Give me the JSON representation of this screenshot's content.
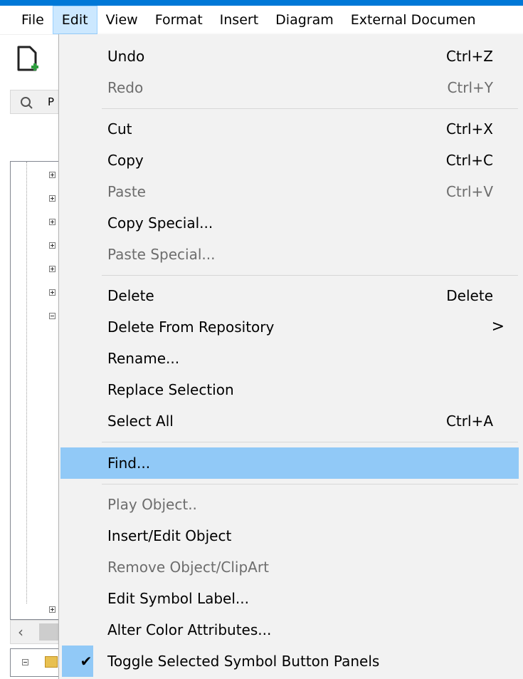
{
  "menubar": {
    "items": [
      {
        "label": "File"
      },
      {
        "label": "Edit"
      },
      {
        "label": "View"
      },
      {
        "label": "Format"
      },
      {
        "label": "Insert"
      },
      {
        "label": "Diagram"
      },
      {
        "label": "External Documen"
      }
    ]
  },
  "background": {
    "toolbar_partial_text": "P"
  },
  "edit_menu": {
    "items": [
      {
        "label": "Undo",
        "shortcut": "Ctrl+Z",
        "disabled": false
      },
      {
        "label": "Redo",
        "shortcut": "Ctrl+Y",
        "disabled": true
      },
      {
        "label": "Cut",
        "shortcut": "Ctrl+X",
        "disabled": false
      },
      {
        "label": "Copy",
        "shortcut": "Ctrl+C",
        "disabled": false
      },
      {
        "label": "Paste",
        "shortcut": "Ctrl+V",
        "disabled": true
      },
      {
        "label": "Copy Special...",
        "shortcut": "",
        "disabled": false
      },
      {
        "label": "Paste Special...",
        "shortcut": "",
        "disabled": true
      },
      {
        "label": "Delete",
        "shortcut": "Delete",
        "disabled": false
      },
      {
        "label": "Delete From Repository",
        "submenu_arrow": ">",
        "disabled": false
      },
      {
        "label": "Rename...",
        "shortcut": "",
        "disabled": false
      },
      {
        "label": "Replace Selection",
        "shortcut": "",
        "disabled": false
      },
      {
        "label": "Select All",
        "shortcut": "Ctrl+A",
        "disabled": false
      },
      {
        "label": "Find...",
        "shortcut": "",
        "disabled": false,
        "highlighted": true
      },
      {
        "label": "Play Object..",
        "shortcut": "",
        "disabled": true
      },
      {
        "label": "Insert/Edit Object",
        "shortcut": "",
        "disabled": false
      },
      {
        "label": "Remove Object/ClipArt",
        "shortcut": "",
        "disabled": true
      },
      {
        "label": "Edit Symbol Label...",
        "shortcut": "",
        "disabled": false
      },
      {
        "label": "Alter Color Attributes...",
        "shortcut": "",
        "disabled": false
      },
      {
        "label": "Toggle Selected Symbol Button Panels",
        "shortcut": "",
        "disabled": false,
        "checked": true,
        "check_glyph": "✔"
      }
    ]
  },
  "colors": {
    "accent_strip": "#0078d7",
    "highlight": "#91c9f7",
    "menu_bg": "#f2f2f2",
    "disabled_text": "#6d6d6d"
  }
}
